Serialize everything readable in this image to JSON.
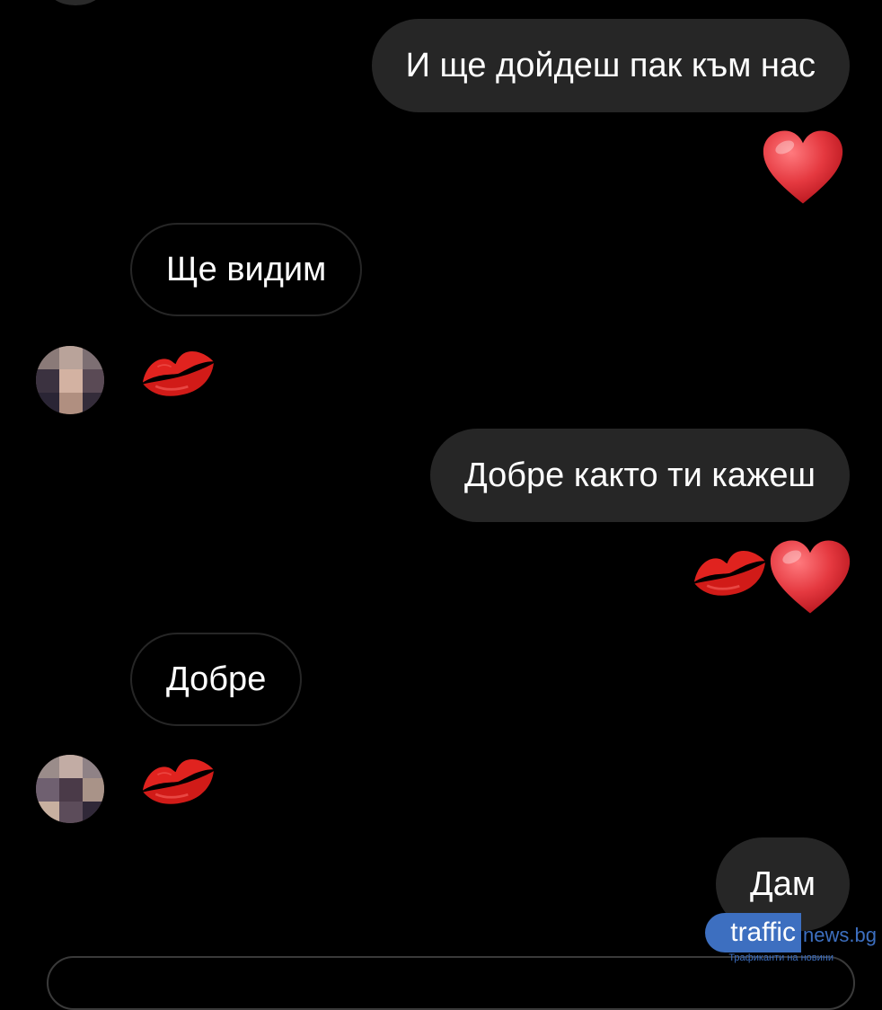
{
  "messages": [
    {
      "side": "out",
      "text": "И ще дойдеш пак към нас"
    },
    {
      "side": "out",
      "emoji": "heart-emoji"
    },
    {
      "side": "in",
      "text": "Ще видим"
    },
    {
      "side": "in",
      "emoji": "kiss-mark-emoji"
    },
    {
      "side": "out",
      "text": "Добре както ти кажеш"
    },
    {
      "side": "out",
      "emoji": "kiss-mark-emoji heart-emoji"
    },
    {
      "side": "in",
      "text": "Добре"
    },
    {
      "side": "in",
      "emoji": "kiss-mark-emoji"
    },
    {
      "side": "out",
      "text": "Дам"
    }
  ],
  "watermark": {
    "badge": "traffic",
    "rest": "news.bg",
    "sub": "Трафиканти на новини"
  },
  "colors": {
    "background": "#000000",
    "outgoing_bubble": "#262626",
    "incoming_border": "#262626",
    "heart": "#e53940",
    "kiss": "#d9201e",
    "watermark": "#3d6fc0"
  }
}
